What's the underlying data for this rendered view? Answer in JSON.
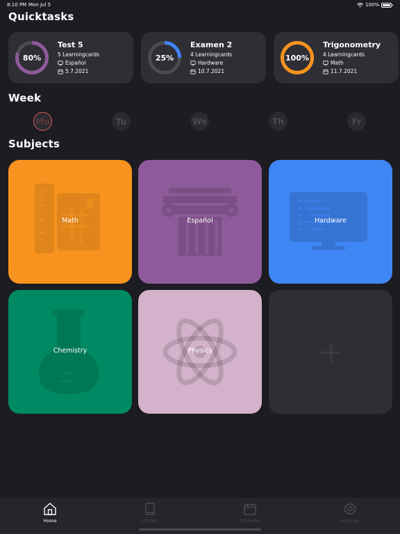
{
  "status_bar": {
    "time": "8:10 PM",
    "date": "Mon Jul 5",
    "battery": "100%"
  },
  "sections": {
    "quicktasks": "Quicktasks",
    "week": "Week",
    "subjects": "Subjects"
  },
  "quicktasks": [
    {
      "title": "Test 5",
      "percent_label": "80%",
      "progress": 0.8,
      "ring_color": "#8e5a9a",
      "cards": "5 Learningcards",
      "subject": "Español",
      "date": "5.7.2021"
    },
    {
      "title": "Examen 2",
      "percent_label": "25%",
      "progress": 0.25,
      "ring_color": "#3f86f5",
      "cards": "4 Learningcards",
      "subject": "Hardware",
      "date": "10.7.2021"
    },
    {
      "title": "Trigonometry",
      "percent_label": "100%",
      "progress": 1.0,
      "ring_color": "#f7931e",
      "cards": "4 Learningcards",
      "subject": "Math",
      "date": "11.7.2021"
    }
  ],
  "week_days": [
    "Mo",
    "Tu",
    "We",
    "Th",
    "Fr"
  ],
  "subjects": [
    {
      "label": "Math",
      "color": "#f7931e"
    },
    {
      "label": "Español",
      "color": "#8e5a9a"
    },
    {
      "label": "Hardware",
      "color": "#3f86f5"
    },
    {
      "label": "Chemistry",
      "color": "#008a63"
    },
    {
      "label": "Physics",
      "color": "#d4b2cc"
    },
    {
      "label": "",
      "color": "#2e2e34"
    }
  ],
  "tabs": [
    {
      "label": "Home",
      "active": true
    },
    {
      "label": "Library",
      "active": false
    },
    {
      "label": "Calendar",
      "active": false
    },
    {
      "label": "Settings",
      "active": false
    }
  ]
}
